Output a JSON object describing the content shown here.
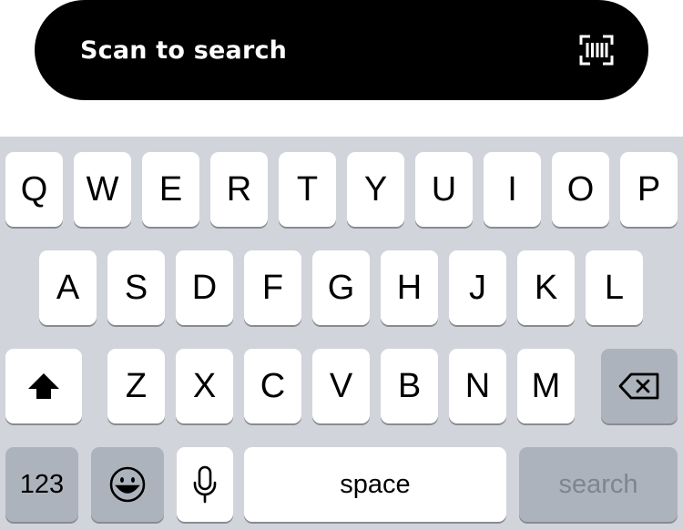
{
  "search_bar": {
    "label": "Scan to search",
    "icon": "barcode-scan-icon"
  },
  "keyboard": {
    "row1": [
      "Q",
      "W",
      "E",
      "R",
      "T",
      "Y",
      "U",
      "I",
      "O",
      "P"
    ],
    "row2": [
      "A",
      "S",
      "D",
      "F",
      "G",
      "H",
      "J",
      "K",
      "L"
    ],
    "row3": [
      "Z",
      "X",
      "C",
      "V",
      "B",
      "N",
      "M"
    ],
    "shift_icon": "shift-arrow-icon",
    "delete_icon": "backspace-icon",
    "numbers_label": "123",
    "emoji_icon": "emoji-icon",
    "mic_icon": "microphone-icon",
    "space_label": "space",
    "search_label": "search"
  },
  "colors": {
    "keyboard_bg": "#d1d4da",
    "key_bg": "#ffffff",
    "dark_key_bg": "#adb3bc",
    "search_text": "#7f858f",
    "bar_bg": "#000000"
  }
}
